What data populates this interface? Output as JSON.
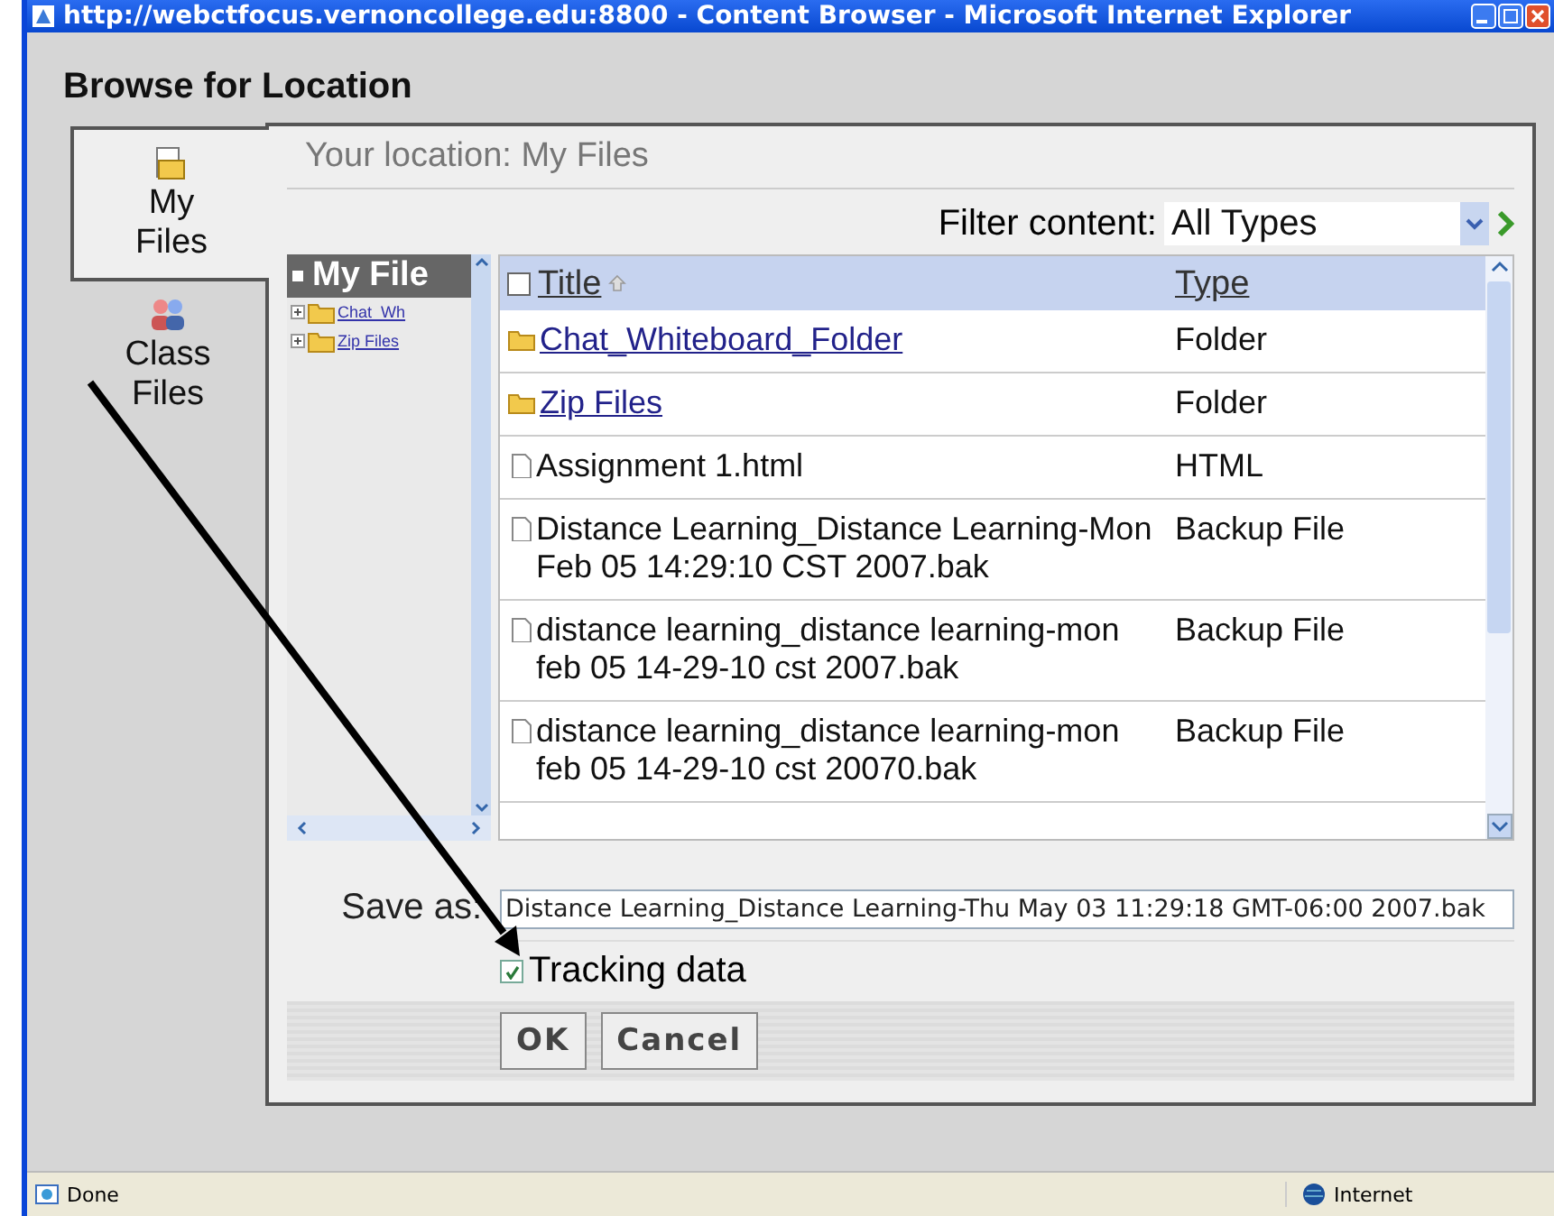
{
  "window": {
    "title": "http://webctfocus.vernoncollege.edu:8800 - Content Browser - Microsoft Internet Explorer"
  },
  "heading": "Browse for Location",
  "tabs": [
    {
      "label": "My Files",
      "selected": true
    },
    {
      "label": "Class Files",
      "selected": false
    }
  ],
  "location": "Your location: My Files",
  "filter": {
    "label": "Filter content:",
    "value": "All Types"
  },
  "tree": {
    "header": "My File",
    "items": [
      {
        "label": "Chat_Wh"
      },
      {
        "label": "Zip Files"
      }
    ]
  },
  "table": {
    "select_all": {
      "checked": false
    },
    "columns": [
      "Title",
      "Type"
    ],
    "rows": [
      {
        "kind": "folder",
        "title": "Chat_Whiteboard_Folder",
        "type": "Folder"
      },
      {
        "kind": "folder",
        "title": "Zip Files",
        "type": "Folder"
      },
      {
        "kind": "file",
        "title": "Assignment 1.html",
        "type": "HTML"
      },
      {
        "kind": "file",
        "title": "Distance Learning_Distance Learning-Mon Feb 05 14:29:10 CST 2007.bak",
        "type": "Backup File"
      },
      {
        "kind": "file",
        "title": "distance learning_distance learning-mon feb 05 14-29-10 cst 2007.bak",
        "type": "Backup File"
      },
      {
        "kind": "file",
        "title": "distance learning_distance learning-mon feb 05 14-29-10 cst 20070.bak",
        "type": "Backup File"
      }
    ]
  },
  "save_as": {
    "label": "Save as:",
    "value": "Distance Learning_Distance Learning-Thu May 03 11:29:18 GMT-06:00 2007.bak"
  },
  "tracking": {
    "label": "Tracking data",
    "checked": true
  },
  "buttons": [
    "OK",
    "Cancel"
  ],
  "status_bar": {
    "left": "Done",
    "right": "Internet"
  }
}
